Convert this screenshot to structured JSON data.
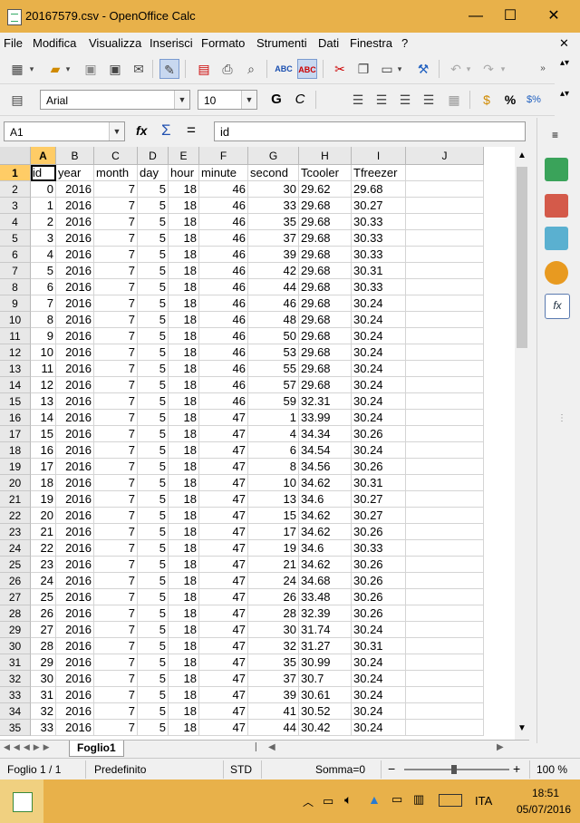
{
  "window": {
    "title": "20167579.csv - OpenOffice Calc",
    "minimize": "—",
    "maximize": "☐",
    "close": "✕"
  },
  "menu": [
    "File",
    "Modifica",
    "Visualizza",
    "Inserisci",
    "Formato",
    "Strumenti",
    "Dati",
    "Finestra",
    "?"
  ],
  "font_toolbar": {
    "font_name": "Arial",
    "font_size": "10",
    "bold_glyph": "G",
    "italic_glyph": "C",
    "percent": "%"
  },
  "formula": {
    "cell_ref": "A1",
    "fx": "fx",
    "sigma": "Σ",
    "equals": "=",
    "content": "id"
  },
  "columns": [
    "A",
    "B",
    "C",
    "D",
    "E",
    "F",
    "G",
    "H",
    "I",
    "J"
  ],
  "rows": [
    [
      "id",
      "year",
      "month",
      "day",
      "hour",
      "minute",
      "second",
      "Tcooler",
      "Tfreezer"
    ],
    [
      "0",
      "2016",
      "7",
      "5",
      "18",
      "46",
      "30",
      "29.62",
      "29.68"
    ],
    [
      "1",
      "2016",
      "7",
      "5",
      "18",
      "46",
      "33",
      "29.68",
      "30.27"
    ],
    [
      "2",
      "2016",
      "7",
      "5",
      "18",
      "46",
      "35",
      "29.68",
      "30.33"
    ],
    [
      "3",
      "2016",
      "7",
      "5",
      "18",
      "46",
      "37",
      "29.68",
      "30.33"
    ],
    [
      "4",
      "2016",
      "7",
      "5",
      "18",
      "46",
      "39",
      "29.68",
      "30.33"
    ],
    [
      "5",
      "2016",
      "7",
      "5",
      "18",
      "46",
      "42",
      "29.68",
      "30.31"
    ],
    [
      "6",
      "2016",
      "7",
      "5",
      "18",
      "46",
      "44",
      "29.68",
      "30.33"
    ],
    [
      "7",
      "2016",
      "7",
      "5",
      "18",
      "46",
      "46",
      "29.68",
      "30.24"
    ],
    [
      "8",
      "2016",
      "7",
      "5",
      "18",
      "46",
      "48",
      "29.68",
      "30.24"
    ],
    [
      "9",
      "2016",
      "7",
      "5",
      "18",
      "46",
      "50",
      "29.68",
      "30.24"
    ],
    [
      "10",
      "2016",
      "7",
      "5",
      "18",
      "46",
      "53",
      "29.68",
      "30.24"
    ],
    [
      "11",
      "2016",
      "7",
      "5",
      "18",
      "46",
      "55",
      "29.68",
      "30.24"
    ],
    [
      "12",
      "2016",
      "7",
      "5",
      "18",
      "46",
      "57",
      "29.68",
      "30.24"
    ],
    [
      "13",
      "2016",
      "7",
      "5",
      "18",
      "46",
      "59",
      "32.31",
      "30.24"
    ],
    [
      "14",
      "2016",
      "7",
      "5",
      "18",
      "47",
      "1",
      "33.99",
      "30.24"
    ],
    [
      "15",
      "2016",
      "7",
      "5",
      "18",
      "47",
      "4",
      "34.34",
      "30.26"
    ],
    [
      "16",
      "2016",
      "7",
      "5",
      "18",
      "47",
      "6",
      "34.54",
      "30.24"
    ],
    [
      "17",
      "2016",
      "7",
      "5",
      "18",
      "47",
      "8",
      "34.56",
      "30.26"
    ],
    [
      "18",
      "2016",
      "7",
      "5",
      "18",
      "47",
      "10",
      "34.62",
      "30.31"
    ],
    [
      "19",
      "2016",
      "7",
      "5",
      "18",
      "47",
      "13",
      "34.6",
      "30.27"
    ],
    [
      "20",
      "2016",
      "7",
      "5",
      "18",
      "47",
      "15",
      "34.62",
      "30.27"
    ],
    [
      "21",
      "2016",
      "7",
      "5",
      "18",
      "47",
      "17",
      "34.62",
      "30.26"
    ],
    [
      "22",
      "2016",
      "7",
      "5",
      "18",
      "47",
      "19",
      "34.6",
      "30.33"
    ],
    [
      "23",
      "2016",
      "7",
      "5",
      "18",
      "47",
      "21",
      "34.62",
      "30.26"
    ],
    [
      "24",
      "2016",
      "7",
      "5",
      "18",
      "47",
      "24",
      "34.68",
      "30.26"
    ],
    [
      "25",
      "2016",
      "7",
      "5",
      "18",
      "47",
      "26",
      "33.48",
      "30.26"
    ],
    [
      "26",
      "2016",
      "7",
      "5",
      "18",
      "47",
      "28",
      "32.39",
      "30.26"
    ],
    [
      "27",
      "2016",
      "7",
      "5",
      "18",
      "47",
      "30",
      "31.74",
      "30.24"
    ],
    [
      "28",
      "2016",
      "7",
      "5",
      "18",
      "47",
      "32",
      "31.27",
      "30.31"
    ],
    [
      "29",
      "2016",
      "7",
      "5",
      "18",
      "47",
      "35",
      "30.99",
      "30.24"
    ],
    [
      "30",
      "2016",
      "7",
      "5",
      "18",
      "47",
      "37",
      "30.7",
      "30.24"
    ],
    [
      "31",
      "2016",
      "7",
      "5",
      "18",
      "47",
      "39",
      "30.61",
      "30.24"
    ],
    [
      "32",
      "2016",
      "7",
      "5",
      "18",
      "47",
      "41",
      "30.52",
      "30.24"
    ],
    [
      "33",
      "2016",
      "7",
      "5",
      "18",
      "47",
      "44",
      "30.42",
      "30.24"
    ]
  ],
  "sheet_tab": "Foglio1",
  "status": {
    "sheet": "Foglio 1 / 1",
    "style": "Predefinito",
    "mode": "STD",
    "sum": "Somma=0",
    "zoom": "100 %",
    "zoom_minus": "−",
    "zoom_plus": "+"
  },
  "taskbar": {
    "language": "ITA",
    "time": "18:51",
    "date": "05/07/2016"
  }
}
